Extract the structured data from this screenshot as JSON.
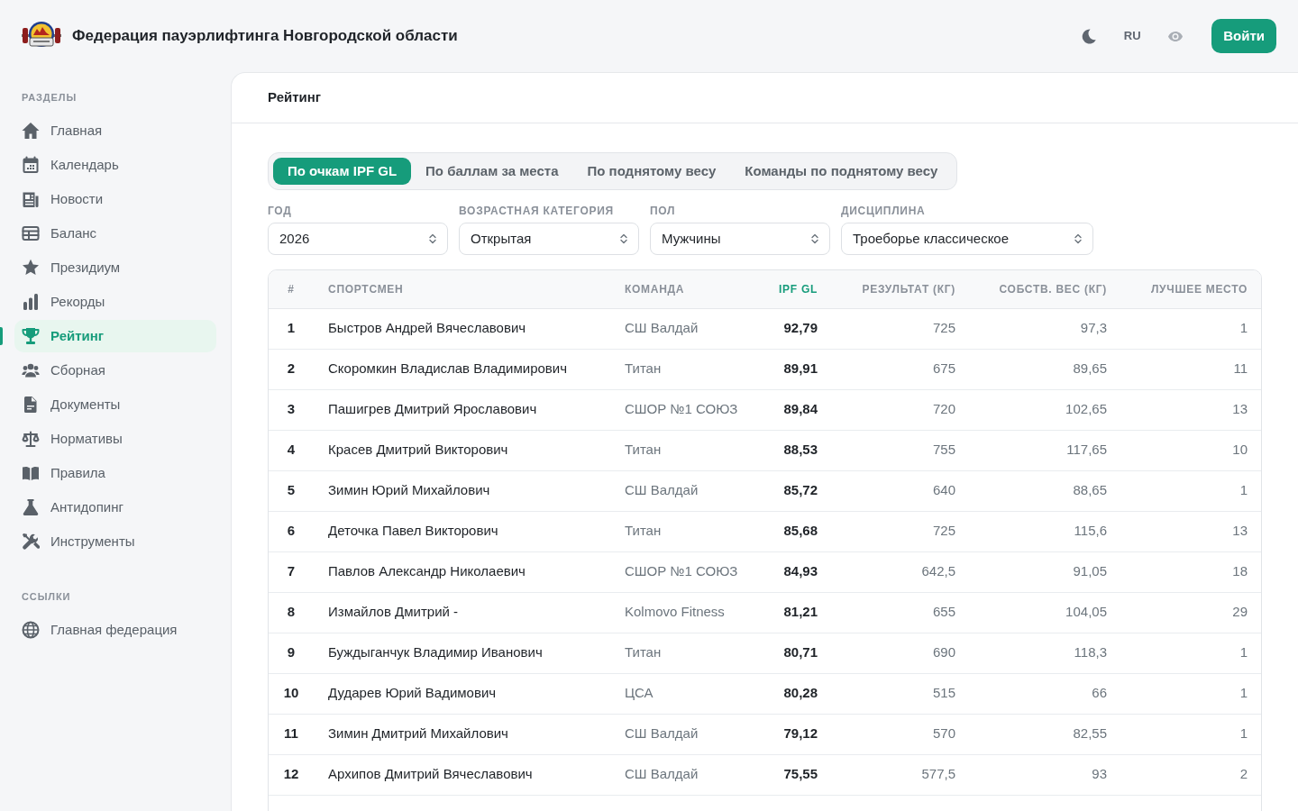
{
  "header": {
    "title": "Федерация пауэрлифтинга Новгородской области",
    "language": "RU",
    "login_button": "Войти"
  },
  "sidebar": {
    "sections": [
      {
        "title": "РАЗДЕЛЫ",
        "items": [
          {
            "label": "Главная",
            "selected": false
          },
          {
            "label": "Календарь",
            "selected": false
          },
          {
            "label": "Новости",
            "selected": false
          },
          {
            "label": "Баланс",
            "selected": false
          },
          {
            "label": "Президиум",
            "selected": false
          },
          {
            "label": "Рекорды",
            "selected": false
          },
          {
            "label": "Рейтинг",
            "selected": true
          },
          {
            "label": "Сборная",
            "selected": false
          },
          {
            "label": "Документы",
            "selected": false
          },
          {
            "label": "Нормативы",
            "selected": false
          },
          {
            "label": "Правила",
            "selected": false
          },
          {
            "label": "Антидопинг",
            "selected": false
          },
          {
            "label": "Инструменты",
            "selected": false
          }
        ]
      },
      {
        "title": "ССЫЛКИ",
        "items": [
          {
            "label": "Главная федерация",
            "selected": false
          }
        ]
      }
    ]
  },
  "page": {
    "title": "Рейтинг"
  },
  "tabs": [
    {
      "label": "По очкам IPF GL",
      "selected": true
    },
    {
      "label": "По баллам за места",
      "selected": false
    },
    {
      "label": "По поднятому весу",
      "selected": false
    },
    {
      "label": "Команды по поднятому весу",
      "selected": false
    }
  ],
  "filters": [
    {
      "label": "ГОД",
      "value": "2026"
    },
    {
      "label": "ВОЗРАСТНАЯ КАТЕГОРИЯ",
      "value": "Открытая"
    },
    {
      "label": "ПОЛ",
      "value": "Мужчины"
    },
    {
      "label": "ДИСЦИПЛИНА",
      "value": "Троеборье классическое"
    }
  ],
  "table": {
    "columns": [
      {
        "label": "#",
        "sorted": false
      },
      {
        "label": "СПОРТСМЕН",
        "sorted": false
      },
      {
        "label": "КОМАНДА",
        "sorted": false
      },
      {
        "label": "IPF GL",
        "sorted": true
      },
      {
        "label": "РЕЗУЛЬТАТ (КГ)",
        "sorted": false
      },
      {
        "label": "СОБСТВ. ВЕС (КГ)",
        "sorted": false
      },
      {
        "label": "ЛУЧШЕЕ МЕСТО",
        "sorted": false
      }
    ],
    "rows": [
      {
        "cells": [
          "1",
          "Быстров Андрей Вячеславович",
          "СШ Валдай",
          "92,79",
          "725",
          "97,3",
          "1"
        ]
      },
      {
        "cells": [
          "2",
          "Скоромкин Владислав Владимирович",
          "Титан",
          "89,91",
          "675",
          "89,65",
          "11"
        ]
      },
      {
        "cells": [
          "3",
          "Пашигрев Дмитрий Ярославович",
          "СШОР №1 СОЮЗ",
          "89,84",
          "720",
          "102,65",
          "13"
        ]
      },
      {
        "cells": [
          "4",
          "Красев Дмитрий Викторович",
          "Титан",
          "88,53",
          "755",
          "117,65",
          "10"
        ]
      },
      {
        "cells": [
          "5",
          "Зимин Юрий Михайлович",
          "СШ Валдай",
          "85,72",
          "640",
          "88,65",
          "1"
        ]
      },
      {
        "cells": [
          "6",
          "Деточка Павел Викторович",
          "Титан",
          "85,68",
          "725",
          "115,6",
          "13"
        ]
      },
      {
        "cells": [
          "7",
          "Павлов Александр Николаевич",
          "СШОР №1 СОЮЗ",
          "84,93",
          "642,5",
          "91,05",
          "18"
        ]
      },
      {
        "cells": [
          "8",
          "Измайлов Дмитрий -",
          "Kolmovo Fitness",
          "81,21",
          "655",
          "104,05",
          "29"
        ]
      },
      {
        "cells": [
          "9",
          "Буждыганчук Владимир Иванович",
          "Титан",
          "80,71",
          "690",
          "118,3",
          "1"
        ]
      },
      {
        "cells": [
          "10",
          "Дударев Юрий Вадимович",
          "ЦСА",
          "80,28",
          "515",
          "66",
          "1"
        ]
      },
      {
        "cells": [
          "11",
          "Зимин Дмитрий Михайлович",
          "СШ Валдай",
          "79,12",
          "570",
          "82,55",
          "1"
        ]
      },
      {
        "cells": [
          "12",
          "Архипов Дмитрий Вячеславович",
          "СШ Валдай",
          "75,55",
          "577,5",
          "93",
          "2"
        ]
      }
    ]
  }
}
